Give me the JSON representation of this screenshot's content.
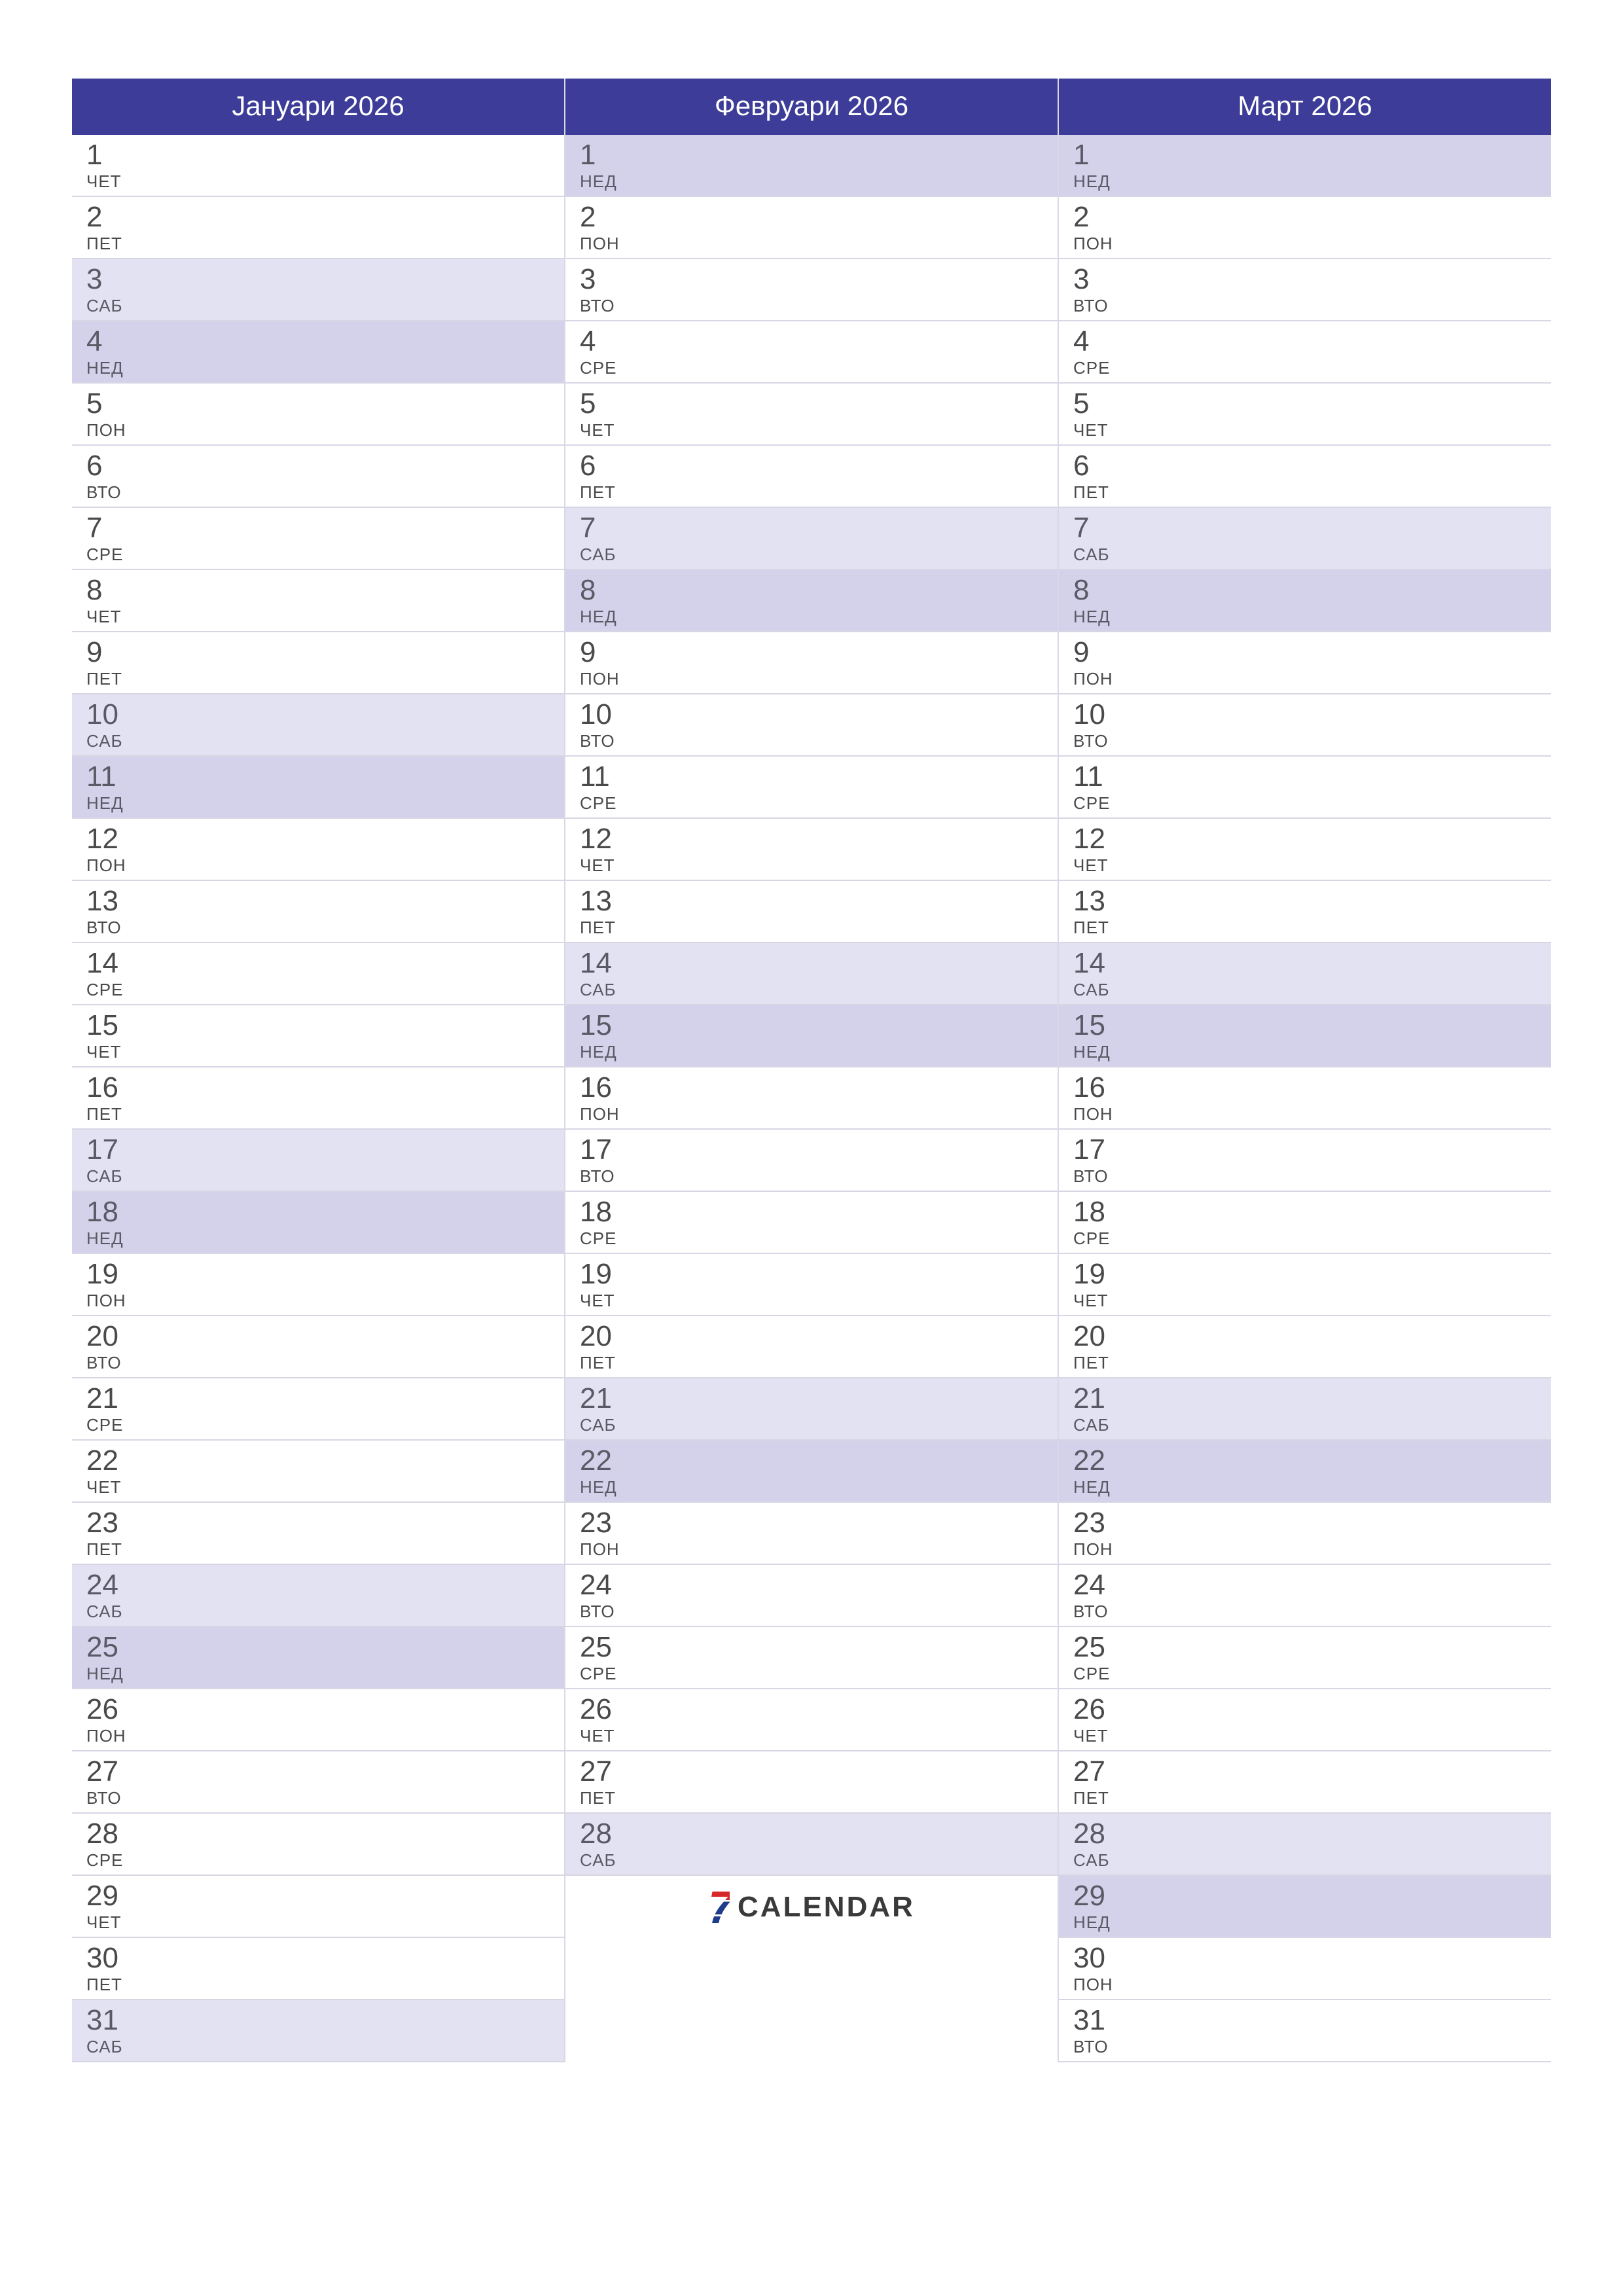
{
  "logo": {
    "digit": "7",
    "word": "CALENDAR"
  },
  "months": [
    {
      "title": "Јануари 2026",
      "days": [
        {
          "n": "1",
          "d": "ЧЕТ",
          "w": false,
          "s": false
        },
        {
          "n": "2",
          "d": "ПЕТ",
          "w": false,
          "s": false
        },
        {
          "n": "3",
          "d": "САБ",
          "w": true,
          "s": false
        },
        {
          "n": "4",
          "d": "НЕД",
          "w": false,
          "s": true
        },
        {
          "n": "5",
          "d": "ПОН",
          "w": false,
          "s": false
        },
        {
          "n": "6",
          "d": "ВТО",
          "w": false,
          "s": false
        },
        {
          "n": "7",
          "d": "СРЕ",
          "w": false,
          "s": false
        },
        {
          "n": "8",
          "d": "ЧЕТ",
          "w": false,
          "s": false
        },
        {
          "n": "9",
          "d": "ПЕТ",
          "w": false,
          "s": false
        },
        {
          "n": "10",
          "d": "САБ",
          "w": true,
          "s": false
        },
        {
          "n": "11",
          "d": "НЕД",
          "w": false,
          "s": true
        },
        {
          "n": "12",
          "d": "ПОН",
          "w": false,
          "s": false
        },
        {
          "n": "13",
          "d": "ВТО",
          "w": false,
          "s": false
        },
        {
          "n": "14",
          "d": "СРЕ",
          "w": false,
          "s": false
        },
        {
          "n": "15",
          "d": "ЧЕТ",
          "w": false,
          "s": false
        },
        {
          "n": "16",
          "d": "ПЕТ",
          "w": false,
          "s": false
        },
        {
          "n": "17",
          "d": "САБ",
          "w": true,
          "s": false
        },
        {
          "n": "18",
          "d": "НЕД",
          "w": false,
          "s": true
        },
        {
          "n": "19",
          "d": "ПОН",
          "w": false,
          "s": false
        },
        {
          "n": "20",
          "d": "ВТО",
          "w": false,
          "s": false
        },
        {
          "n": "21",
          "d": "СРЕ",
          "w": false,
          "s": false
        },
        {
          "n": "22",
          "d": "ЧЕТ",
          "w": false,
          "s": false
        },
        {
          "n": "23",
          "d": "ПЕТ",
          "w": false,
          "s": false
        },
        {
          "n": "24",
          "d": "САБ",
          "w": true,
          "s": false
        },
        {
          "n": "25",
          "d": "НЕД",
          "w": false,
          "s": true
        },
        {
          "n": "26",
          "d": "ПОН",
          "w": false,
          "s": false
        },
        {
          "n": "27",
          "d": "ВТО",
          "w": false,
          "s": false
        },
        {
          "n": "28",
          "d": "СРЕ",
          "w": false,
          "s": false
        },
        {
          "n": "29",
          "d": "ЧЕТ",
          "w": false,
          "s": false
        },
        {
          "n": "30",
          "d": "ПЕТ",
          "w": false,
          "s": false
        },
        {
          "n": "31",
          "d": "САБ",
          "w": true,
          "s": false
        }
      ]
    },
    {
      "title": "Февруари 2026",
      "days": [
        {
          "n": "1",
          "d": "НЕД",
          "w": false,
          "s": true
        },
        {
          "n": "2",
          "d": "ПОН",
          "w": false,
          "s": false
        },
        {
          "n": "3",
          "d": "ВТО",
          "w": false,
          "s": false
        },
        {
          "n": "4",
          "d": "СРЕ",
          "w": false,
          "s": false
        },
        {
          "n": "5",
          "d": "ЧЕТ",
          "w": false,
          "s": false
        },
        {
          "n": "6",
          "d": "ПЕТ",
          "w": false,
          "s": false
        },
        {
          "n": "7",
          "d": "САБ",
          "w": true,
          "s": false
        },
        {
          "n": "8",
          "d": "НЕД",
          "w": false,
          "s": true
        },
        {
          "n": "9",
          "d": "ПОН",
          "w": false,
          "s": false
        },
        {
          "n": "10",
          "d": "ВТО",
          "w": false,
          "s": false
        },
        {
          "n": "11",
          "d": "СРЕ",
          "w": false,
          "s": false
        },
        {
          "n": "12",
          "d": "ЧЕТ",
          "w": false,
          "s": false
        },
        {
          "n": "13",
          "d": "ПЕТ",
          "w": false,
          "s": false
        },
        {
          "n": "14",
          "d": "САБ",
          "w": true,
          "s": false
        },
        {
          "n": "15",
          "d": "НЕД",
          "w": false,
          "s": true
        },
        {
          "n": "16",
          "d": "ПОН",
          "w": false,
          "s": false
        },
        {
          "n": "17",
          "d": "ВТО",
          "w": false,
          "s": false
        },
        {
          "n": "18",
          "d": "СРЕ",
          "w": false,
          "s": false
        },
        {
          "n": "19",
          "d": "ЧЕТ",
          "w": false,
          "s": false
        },
        {
          "n": "20",
          "d": "ПЕТ",
          "w": false,
          "s": false
        },
        {
          "n": "21",
          "d": "САБ",
          "w": true,
          "s": false
        },
        {
          "n": "22",
          "d": "НЕД",
          "w": false,
          "s": true
        },
        {
          "n": "23",
          "d": "ПОН",
          "w": false,
          "s": false
        },
        {
          "n": "24",
          "d": "ВТО",
          "w": false,
          "s": false
        },
        {
          "n": "25",
          "d": "СРЕ",
          "w": false,
          "s": false
        },
        {
          "n": "26",
          "d": "ЧЕТ",
          "w": false,
          "s": false
        },
        {
          "n": "27",
          "d": "ПЕТ",
          "w": false,
          "s": false
        },
        {
          "n": "28",
          "d": "САБ",
          "w": true,
          "s": false
        }
      ]
    },
    {
      "title": "Март 2026",
      "days": [
        {
          "n": "1",
          "d": "НЕД",
          "w": false,
          "s": true
        },
        {
          "n": "2",
          "d": "ПОН",
          "w": false,
          "s": false
        },
        {
          "n": "3",
          "d": "ВТО",
          "w": false,
          "s": false
        },
        {
          "n": "4",
          "d": "СРЕ",
          "w": false,
          "s": false
        },
        {
          "n": "5",
          "d": "ЧЕТ",
          "w": false,
          "s": false
        },
        {
          "n": "6",
          "d": "ПЕТ",
          "w": false,
          "s": false
        },
        {
          "n": "7",
          "d": "САБ",
          "w": true,
          "s": false
        },
        {
          "n": "8",
          "d": "НЕД",
          "w": false,
          "s": true
        },
        {
          "n": "9",
          "d": "ПОН",
          "w": false,
          "s": false
        },
        {
          "n": "10",
          "d": "ВТО",
          "w": false,
          "s": false
        },
        {
          "n": "11",
          "d": "СРЕ",
          "w": false,
          "s": false
        },
        {
          "n": "12",
          "d": "ЧЕТ",
          "w": false,
          "s": false
        },
        {
          "n": "13",
          "d": "ПЕТ",
          "w": false,
          "s": false
        },
        {
          "n": "14",
          "d": "САБ",
          "w": true,
          "s": false
        },
        {
          "n": "15",
          "d": "НЕД",
          "w": false,
          "s": true
        },
        {
          "n": "16",
          "d": "ПОН",
          "w": false,
          "s": false
        },
        {
          "n": "17",
          "d": "ВТО",
          "w": false,
          "s": false
        },
        {
          "n": "18",
          "d": "СРЕ",
          "w": false,
          "s": false
        },
        {
          "n": "19",
          "d": "ЧЕТ",
          "w": false,
          "s": false
        },
        {
          "n": "20",
          "d": "ПЕТ",
          "w": false,
          "s": false
        },
        {
          "n": "21",
          "d": "САБ",
          "w": true,
          "s": false
        },
        {
          "n": "22",
          "d": "НЕД",
          "w": false,
          "s": true
        },
        {
          "n": "23",
          "d": "ПОН",
          "w": false,
          "s": false
        },
        {
          "n": "24",
          "d": "ВТО",
          "w": false,
          "s": false
        },
        {
          "n": "25",
          "d": "СРЕ",
          "w": false,
          "s": false
        },
        {
          "n": "26",
          "d": "ЧЕТ",
          "w": false,
          "s": false
        },
        {
          "n": "27",
          "d": "ПЕТ",
          "w": false,
          "s": false
        },
        {
          "n": "28",
          "d": "САБ",
          "w": true,
          "s": false
        },
        {
          "n": "29",
          "d": "НЕД",
          "w": false,
          "s": true
        },
        {
          "n": "30",
          "d": "ПОН",
          "w": false,
          "s": false
        },
        {
          "n": "31",
          "d": "ВТО",
          "w": false,
          "s": false
        }
      ]
    }
  ]
}
